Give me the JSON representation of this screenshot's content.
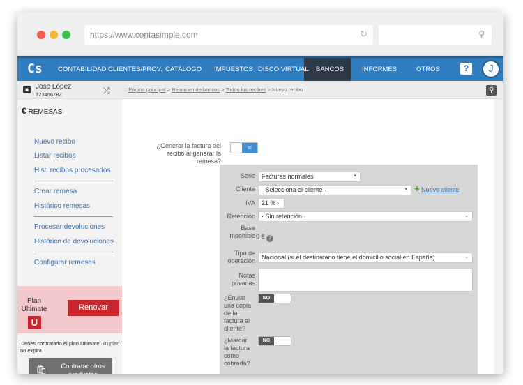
{
  "browser": {
    "url": "https://www.contasimple.com",
    "reload_icon": "reload-icon",
    "search_icon": "magnifier-icon",
    "dot_colors": [
      "#f45b4f",
      "#f5b935",
      "#39c44b"
    ]
  },
  "nav": {
    "logo": "Cs",
    "items": [
      "CONTABILIDAD",
      "CLIENTES/PROV.",
      "CATÁLOGO",
      "IMPUESTOS",
      "DISCO VIRTUAL",
      "BANCOS",
      "INFORMES",
      "OTROS"
    ],
    "active": "BANCOS",
    "help": "?",
    "avatar": "J",
    "accent": "#2f7dbf"
  },
  "user": {
    "name": "Jose López",
    "id": "12345678Z"
  },
  "breadcrumb": {
    "prefix": "::",
    "links": [
      "Página principal",
      "Resumen de bancos",
      "Todos los recibos"
    ],
    "sep": ">",
    "current": "Nuevo recibo"
  },
  "sidebar": {
    "title": "REMESAS",
    "currency_symbol": "€",
    "items": [
      "Nuevo recibo",
      "Listar recibos",
      "Hist. recibos procesados",
      "Crear remesa",
      "Histórico remesas",
      "Procesar devoluciones",
      "Histórico de devoluciones",
      "Configurar remesas"
    ],
    "plan_label_1": "Plan",
    "plan_label_2": "Ultimate",
    "plan_badge": "U",
    "renew": "Renovar",
    "plan_note": "Tienes contratado el plan Ultimate. Tu plan no expira.",
    "contract": "Contratar otros productos"
  },
  "form": {
    "generate_label": "¿Generar la factura del recibo al generar la remesa?",
    "generate_value": "sí",
    "serie_label": "Serie",
    "serie_value": "Facturas normales",
    "cliente_label": "Cliente",
    "cliente_value": "· Selecciona el cliente ·",
    "new_client": "Nuevo cliente",
    "iva_label": "IVA",
    "iva_value": "21 %",
    "retencion_label": "Retención",
    "retencion_value": "· Sin retención ·",
    "base_label": "Base imponible",
    "base_value": "0 €",
    "tipo_label": "Tipo de operación",
    "tipo_value": "Nacional (si el destinatario tiene el domicilio social en España)",
    "notas_label": "Notas privadas",
    "notas_value": "",
    "enviar_label": "¿Enviar una copia de la factura al cliente?",
    "enviar_value": "NO",
    "marcar_label": "¿Marcar la factura como cobrada?",
    "marcar_value": "NO"
  }
}
